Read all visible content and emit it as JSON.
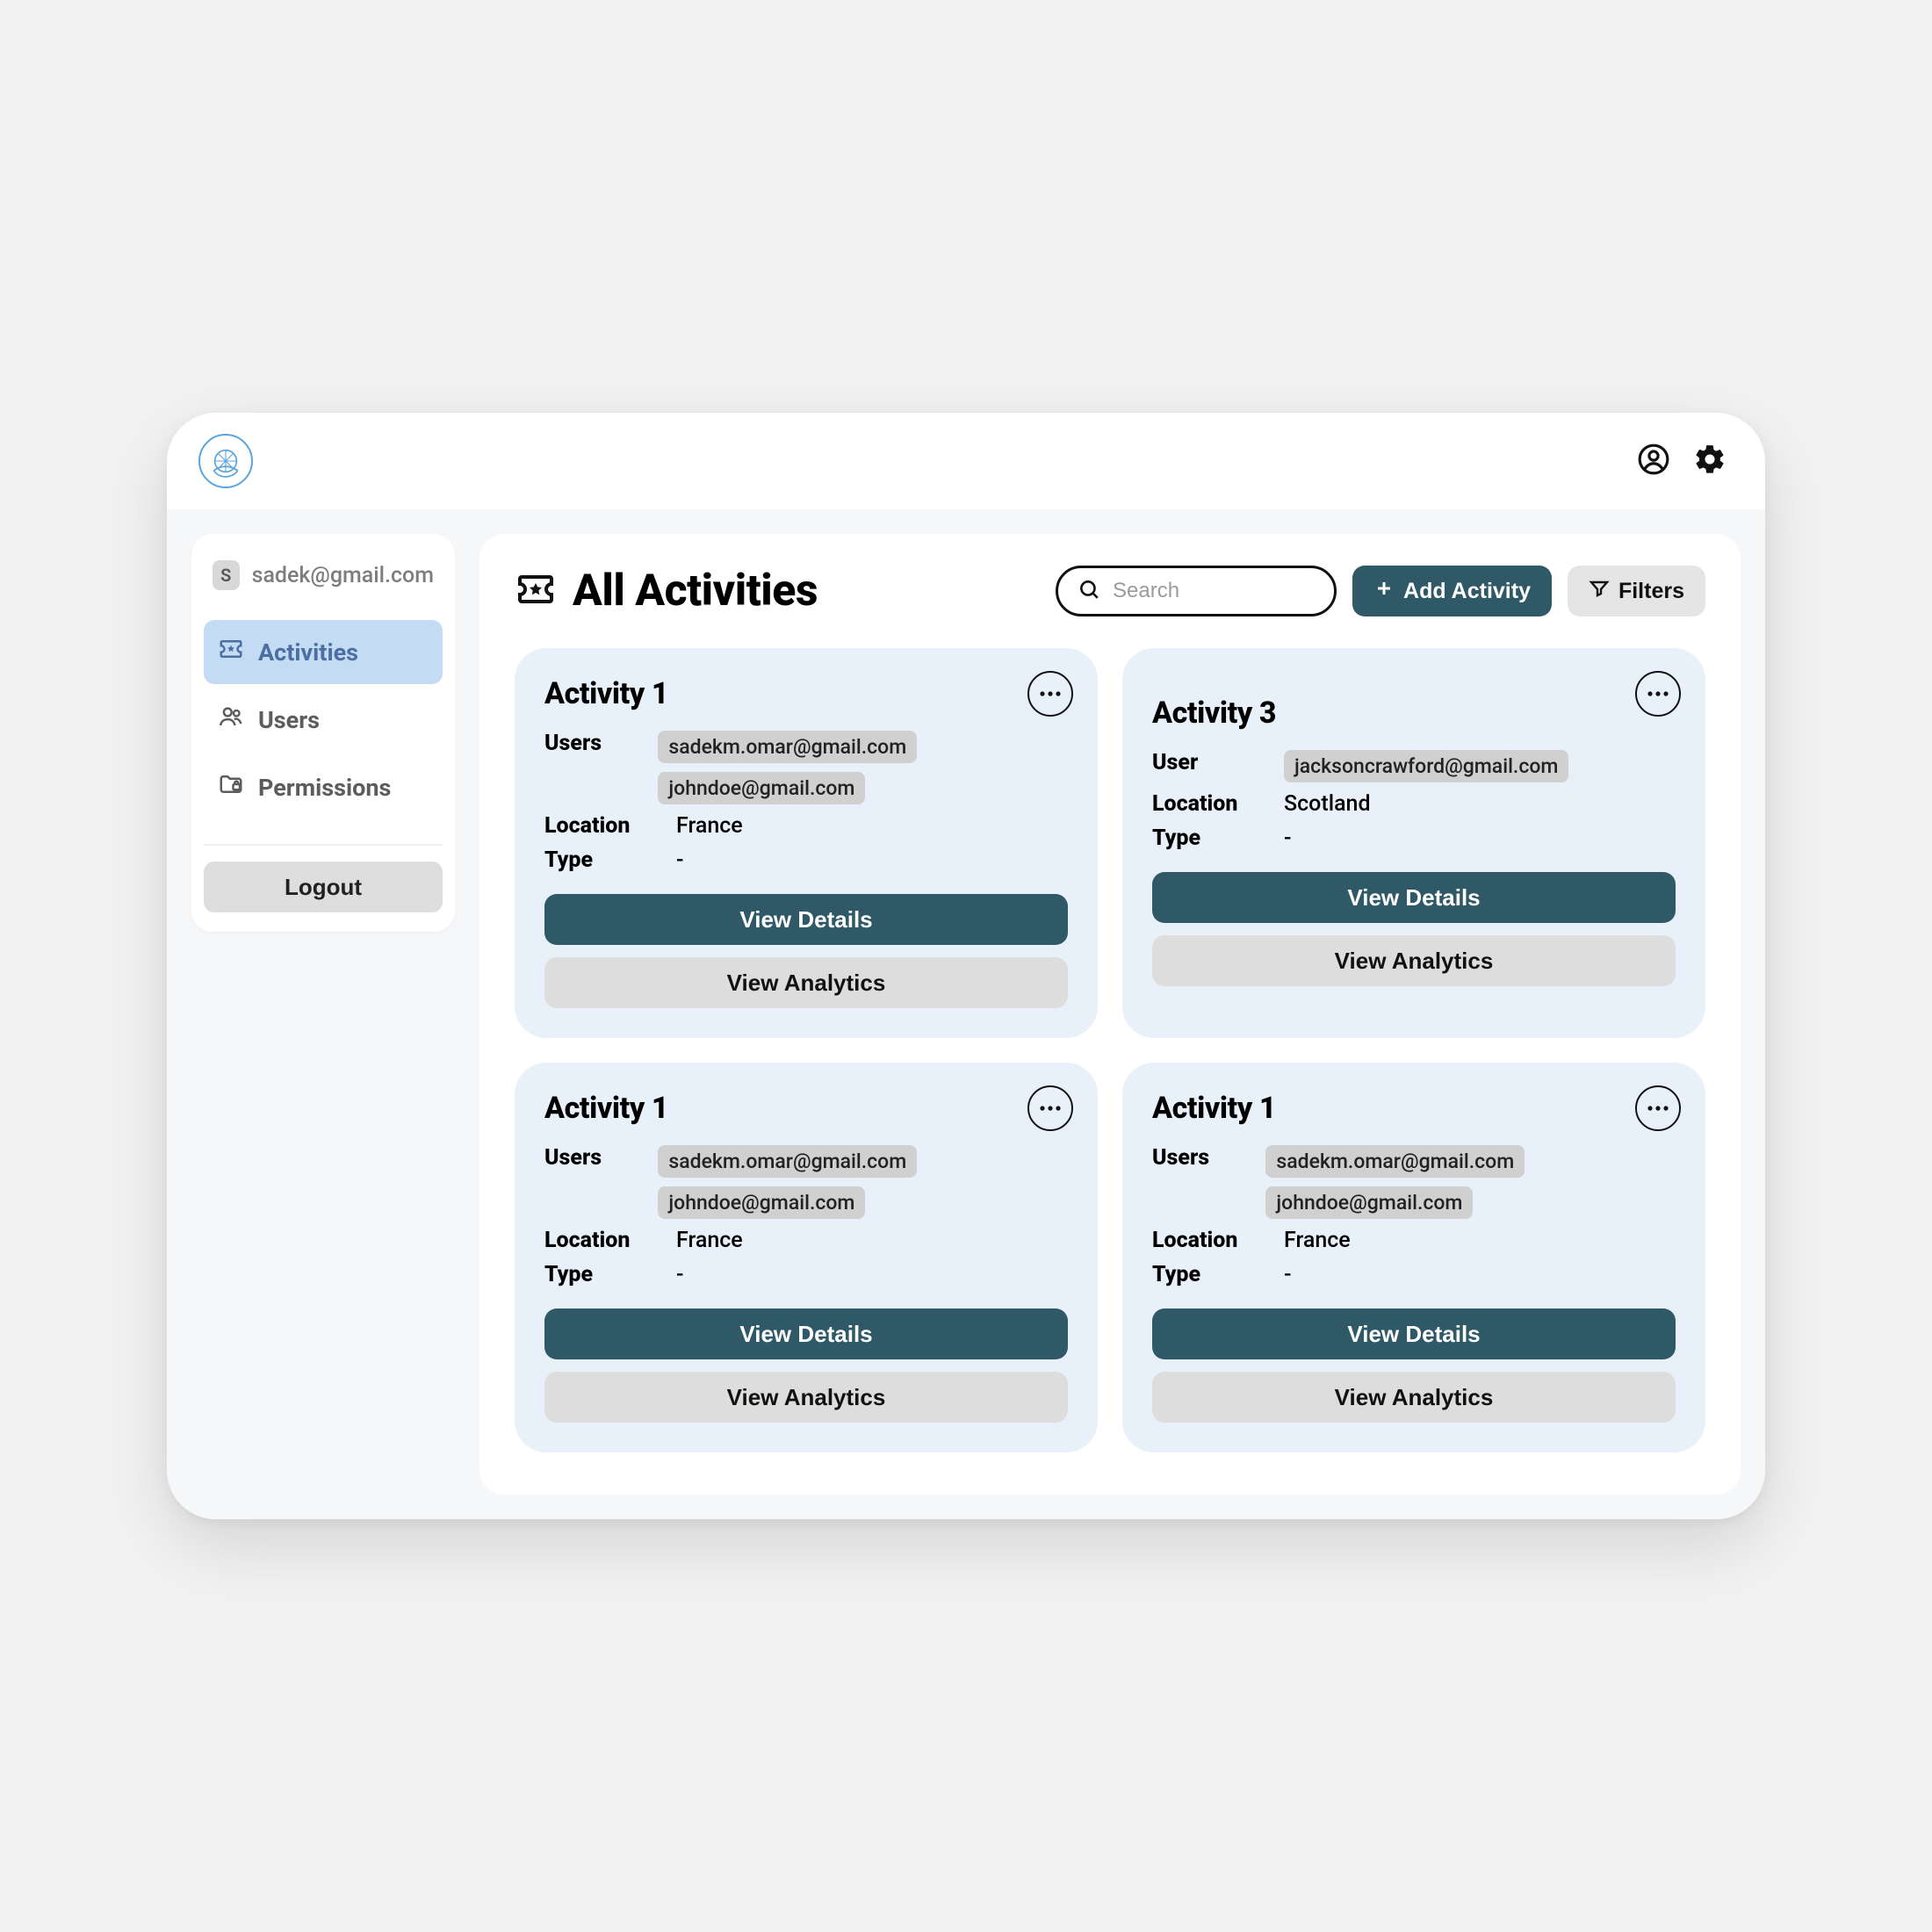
{
  "header": {
    "user_email": "sadek@gmail.com",
    "user_initial": "S"
  },
  "sidebar": {
    "items": [
      {
        "label": "Activities",
        "icon": "ticket",
        "active": true
      },
      {
        "label": "Users",
        "icon": "users",
        "active": false
      },
      {
        "label": "Permissions",
        "icon": "folder-lock",
        "active": false
      }
    ],
    "logout_label": "Logout"
  },
  "main": {
    "page_title": "All Activities",
    "search_placeholder": "Search",
    "add_button_label": "Add Activity",
    "filters_button_label": "Filters",
    "labels": {
      "users_plural": "Users",
      "users_singular": "User",
      "location": "Location",
      "type": "Type",
      "view_details": "View Details",
      "view_analytics": "View Analytics"
    },
    "activities": [
      {
        "title": "Activity 1",
        "users": [
          "sadekm.omar@gmail.com",
          "johndoe@gmail.com"
        ],
        "location": "France",
        "type": "-",
        "offset": false
      },
      {
        "title": "Activity 3",
        "users": [
          "jacksoncrawford@gmail.com"
        ],
        "location": "Scotland",
        "type": "-",
        "offset": true
      },
      {
        "title": "Activity 1",
        "users": [
          "sadekm.omar@gmail.com",
          "johndoe@gmail.com"
        ],
        "location": "France",
        "type": "-",
        "offset": false
      },
      {
        "title": "Activity 1",
        "users": [
          "sadekm.omar@gmail.com",
          "johndoe@gmail.com"
        ],
        "location": "France",
        "type": "-",
        "offset": false
      }
    ]
  },
  "colors": {
    "accent": "#2f5966",
    "sidebar_active": "#c4dbf4",
    "card_bg": "#e8f1fa"
  }
}
